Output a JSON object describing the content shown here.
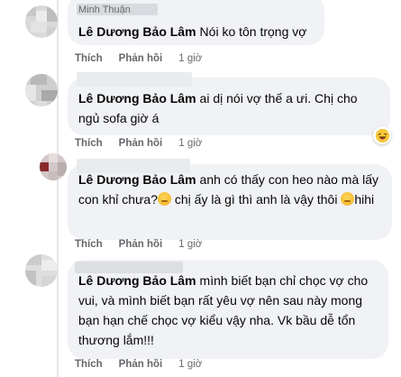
{
  "comments": [
    {
      "top_redacted_name": "Minh Thuận",
      "author": "Lê Dương Bảo Lâm",
      "text": "Nói ko tôn trọng vợ",
      "like": "Thích",
      "reply": "Phản hồi",
      "time": "1 giờ"
    },
    {
      "author": "Lê Dương Bảo Lâm",
      "text": "ai dị nói vợ thế a ưi. Chị cho ngủ sofa giờ á",
      "like": "Thích",
      "reply": "Phản hồi",
      "time": "1 giờ",
      "reaction": "haha-icon"
    },
    {
      "author": "Lê Dương Bảo Lâm",
      "text_part1": "anh có thấy con heo nào mà lấy con khỉ chưa?",
      "text_part2": " chị ấy là gì thì anh là vậy thôi ",
      "text_part3": "hihi",
      "like": "Thích",
      "reply": "Phản hồi",
      "time": "1 giờ"
    },
    {
      "author": "Lê Dương Bảo Lâm",
      "text": "mình biết bạn chỉ chọc vợ cho vui, và mình biết bạn rất yêu vợ nên sau này mong bạn hạn chế chọc vợ kiểu vậy nha. Vk bầu dễ tổn thương lắm!!!",
      "like": "Thích",
      "reply": "Phản hồi",
      "time": "1 giờ"
    }
  ],
  "colors": {
    "bubble": "#f0f2f5",
    "meta": "#65676b",
    "text": "#050505"
  }
}
